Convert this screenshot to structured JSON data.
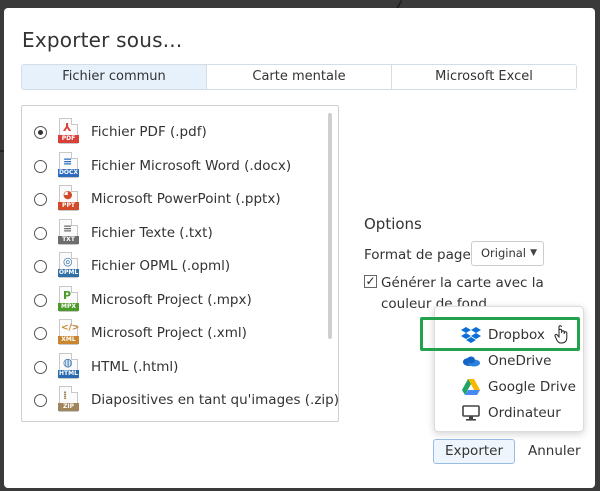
{
  "dialog": {
    "title": "Exporter sous..."
  },
  "tabs": [
    {
      "label": "Fichier commun",
      "active": true
    },
    {
      "label": "Carte mentale",
      "active": false
    },
    {
      "label": "Microsoft Excel",
      "active": false
    }
  ],
  "formats": [
    {
      "label": "Fichier PDF (.pdf)",
      "icon": "pdf-file-icon",
      "tag": "PDF",
      "color": "#d9403a",
      "selected": true
    },
    {
      "label": "Fichier Microsoft Word (.docx)",
      "icon": "docx-file-icon",
      "tag": "DOCX",
      "color": "#2d6bbf",
      "selected": false
    },
    {
      "label": "Microsoft PowerPoint (.pptx)",
      "icon": "pptx-file-icon",
      "tag": "PPT",
      "color": "#d14b2b",
      "selected": false
    },
    {
      "label": "Fichier Texte (.txt)",
      "icon": "txt-file-icon",
      "tag": "TXT",
      "color": "#6d6d6d",
      "selected": false
    },
    {
      "label": "Fichier OPML (.opml)",
      "icon": "opml-file-icon",
      "tag": "OPML",
      "color": "#2f6fa8",
      "selected": false
    },
    {
      "label": "Microsoft Project (.mpx)",
      "icon": "mpx-file-icon",
      "tag": "MPX",
      "color": "#4c9a2a",
      "selected": false
    },
    {
      "label": "Microsoft Project (.xml)",
      "icon": "xml-file-icon",
      "tag": "XML",
      "color": "#c9862e",
      "selected": false
    },
    {
      "label": "HTML (.html)",
      "icon": "html-file-icon",
      "tag": "HTML",
      "color": "#2b6cb0",
      "selected": false
    },
    {
      "label": "Diapositives en tant qu'images (.zip)",
      "icon": "zip-file-icon",
      "tag": "ZIP",
      "color": "#a0845c",
      "selected": false
    }
  ],
  "options": {
    "heading": "Options",
    "page_format_label": "Format de page",
    "page_format_value": "Original",
    "generate_line1": "Générer la carte avec la",
    "generate_line2": "couleur de fond",
    "generate_checked": true
  },
  "destinations": [
    {
      "label": "Dropbox",
      "icon": "dropbox-icon",
      "highlighted": true
    },
    {
      "label": "OneDrive",
      "icon": "onedrive-icon",
      "highlighted": false
    },
    {
      "label": "Google Drive",
      "icon": "google-drive-icon",
      "highlighted": false
    },
    {
      "label": "Ordinateur",
      "icon": "computer-icon",
      "highlighted": false
    }
  ],
  "buttons": {
    "export": "Exporter",
    "cancel": "Annuler"
  },
  "colors": {
    "highlight": "#22a24a",
    "active_tab": "#e6f1fb",
    "backdrop": "#3a3a3a"
  }
}
